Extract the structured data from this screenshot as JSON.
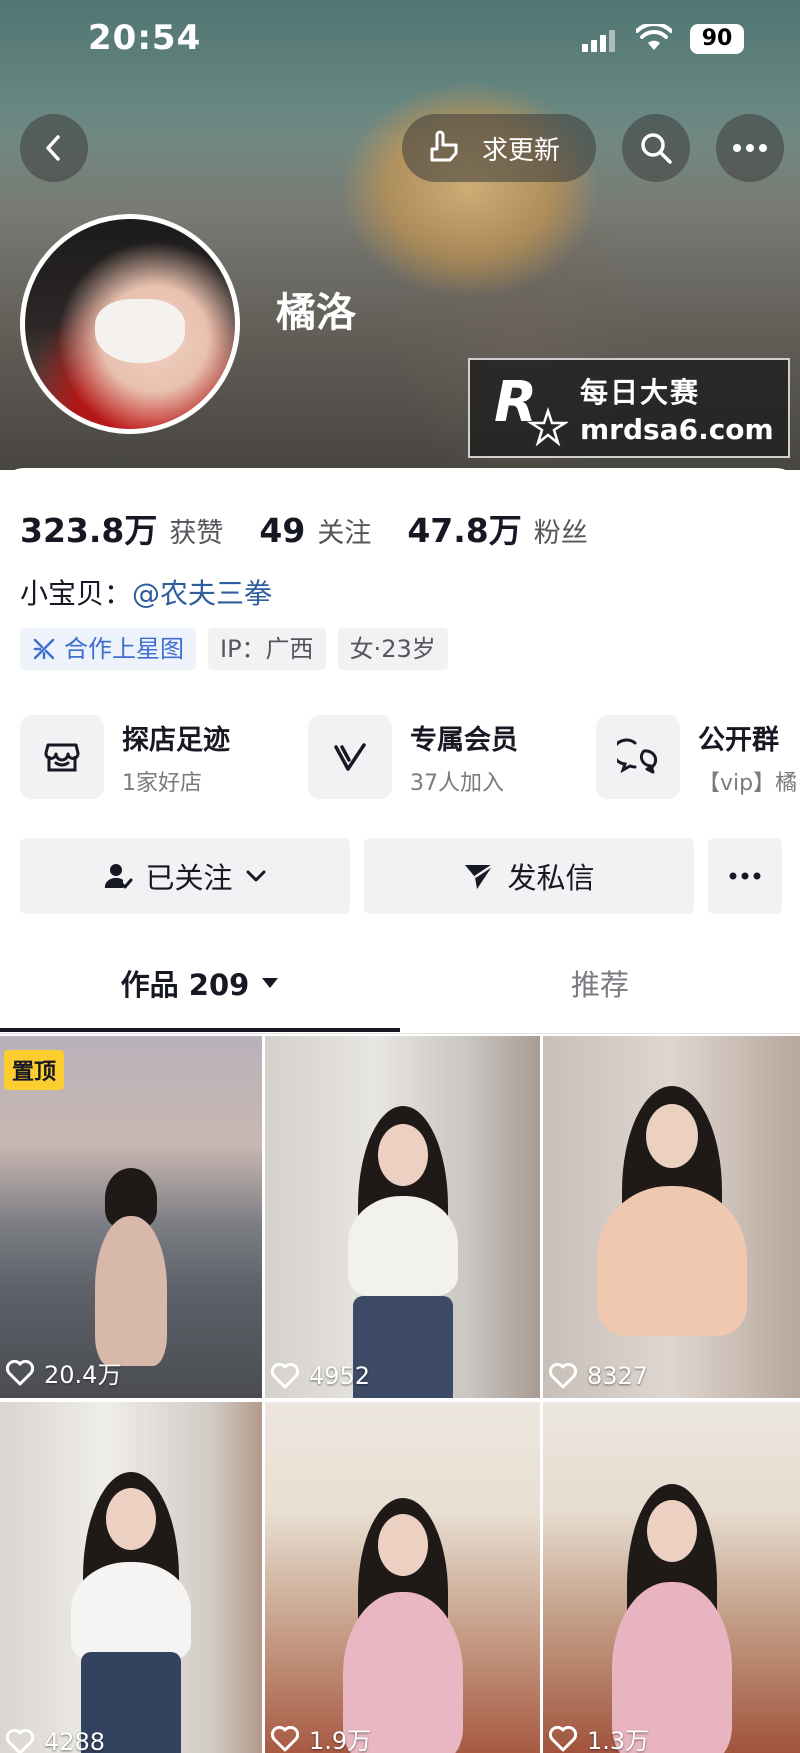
{
  "status_bar": {
    "time": "20:54",
    "battery": "90"
  },
  "header": {
    "update_label": "求更新",
    "nickname": "橘洛"
  },
  "watermark": {
    "line1": "每日大赛",
    "line2": "mrdsa6.com"
  },
  "stats": [
    {
      "value": "323.8万",
      "label": "获赞"
    },
    {
      "value": "49",
      "label": "关注"
    },
    {
      "value": "47.8万",
      "label": "粉丝"
    }
  ],
  "bio": {
    "prefix": "小宝贝：",
    "mention": "@农夫三拳"
  },
  "tags": [
    {
      "label": "合作上星图",
      "icon": "star-map-icon"
    },
    {
      "label": "IP：广西"
    },
    {
      "label": "女·23岁"
    }
  ],
  "features": [
    {
      "title": "探店足迹",
      "subtitle": "1家好店",
      "icon": "shop-icon"
    },
    {
      "title": "专属会员",
      "subtitle": "37人加入",
      "icon": "member-v-icon"
    },
    {
      "title": "公开群",
      "subtitle": "【vip】橘",
      "icon": "group-chat-icon"
    }
  ],
  "actions": {
    "follow_label": "已关注",
    "message_label": "发私信",
    "more_label": "···"
  },
  "tabs": {
    "works_label": "作品 209",
    "recommend_label": "推荐"
  },
  "videos": [
    {
      "likes": "20.4万",
      "pinned": true,
      "pin_label": "置顶"
    },
    {
      "likes": "4952",
      "pinned": false
    },
    {
      "likes": "8327",
      "pinned": false
    },
    {
      "likes": "4288",
      "pinned": false
    },
    {
      "likes": "1.9万",
      "pinned": false
    },
    {
      "likes": "1.3万",
      "pinned": false
    }
  ],
  "colors": {
    "text_primary": "#161823",
    "text_secondary": "#55565c",
    "mention": "#2f5d9e",
    "tag_blue": "#3f6fd1",
    "pin_badge": "#fccd2e"
  }
}
